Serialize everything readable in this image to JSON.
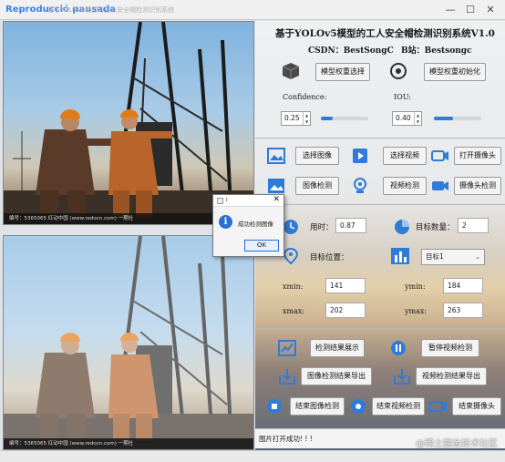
{
  "titlebar": {
    "overlay_text": "Reproducció pausada",
    "window_title": "基于YOLOv5模型的工人安全帽检测识别系统",
    "minimize": "—",
    "maximize": "☐",
    "close": "✕"
  },
  "image_top": {
    "caption": "编号：5365065   红动中国 (www.redocn.com)   一期社"
  },
  "image_bottom": {
    "caption": "编号：5365065   红动中国 (www.redocn.com)   一期社"
  },
  "header": {
    "title": "基于YOLOv5模型的工人安全帽检测识别系统V1.0",
    "csdn": "CSDN：BestSongC",
    "bilibili": "B站：Bestsongc"
  },
  "model": {
    "select_label": "模型权重选择",
    "init_label": "模型权重初始化"
  },
  "params": {
    "confidence_label": "Confidence:",
    "confidence_value": "0.25",
    "confidence_fill": 0.25,
    "iou_label": "IOU:",
    "iou_value": "0.40",
    "iou_fill": 0.4
  },
  "actions": {
    "select_image": "选择图像",
    "select_video": "选择视频",
    "open_camera": "打开摄像头",
    "detect_image": "图像检测",
    "detect_video": "视频检测",
    "detect_camera": "摄像头检测"
  },
  "results": {
    "time_label": "用时：",
    "time_value": "0.87",
    "count_label": "目标数量：",
    "count_value": "2",
    "position_label": "目标位置：",
    "target_select": "目标1",
    "xmin_label": "xmin:",
    "xmin_value": "141",
    "ymin_label": "ymin:",
    "ymin_value": "184",
    "xmax_label": "xmax:",
    "xmax_value": "202",
    "ymax_label": "ymax:",
    "ymax_value": "263"
  },
  "controls": {
    "show_result": "检测结果展示",
    "pause_video": "暂停视频检测",
    "export_image": "图像检测结果导出",
    "export_video": "视频检测结果导出",
    "end_image": "结束图像检测",
    "end_video": "结束视频检测",
    "end_camera": "结束摄像头"
  },
  "status": {
    "message": "图片打开成功! ! !"
  },
  "watermark": "@稀土掘金技术社区",
  "dialog": {
    "title": "i",
    "message": "成功检测图像",
    "ok_label": "OK",
    "info_glyph": "i",
    "close": "✕"
  },
  "colors": {
    "accent": "#2f7bd8",
    "helmet": "#e27a16"
  }
}
